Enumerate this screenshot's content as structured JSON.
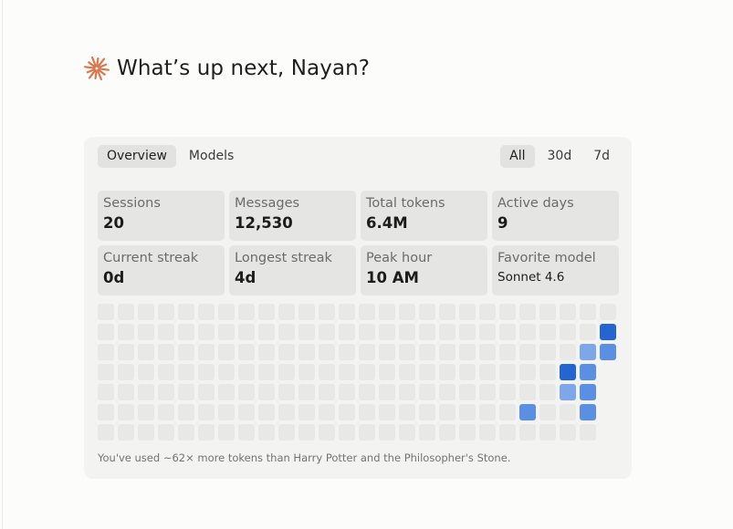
{
  "greeting": {
    "icon": "sparkle-icon",
    "text": "What’s up next, Nayan?",
    "accent_color": "#d9774f"
  },
  "tabs": {
    "left": [
      {
        "label": "Overview",
        "active": true
      },
      {
        "label": "Models",
        "active": false
      }
    ],
    "right": [
      {
        "label": "All",
        "active": true
      },
      {
        "label": "30d",
        "active": false
      },
      {
        "label": "7d",
        "active": false
      }
    ]
  },
  "stats": [
    {
      "label": "Sessions",
      "value": "20"
    },
    {
      "label": "Messages",
      "value": "12,530"
    },
    {
      "label": "Total tokens",
      "value": "6.4M"
    },
    {
      "label": "Active days",
      "value": "9"
    },
    {
      "label": "Current streak",
      "value": "0d"
    },
    {
      "label": "Longest streak",
      "value": "4d"
    },
    {
      "label": "Peak hour",
      "value": "10 AM"
    },
    {
      "label": "Favorite model",
      "value": "Sonnet 4.6"
    }
  ],
  "heatmap": {
    "columns": 26,
    "rows": 7,
    "colors": {
      "empty": "#e8e8e6",
      "level1": "#7ea7ea",
      "level2": "#5a8fe3",
      "level3": "#2565d1"
    },
    "active_cells": [
      {
        "col": 21,
        "row": 5,
        "level": 2
      },
      {
        "col": 23,
        "row": 3,
        "level": 3
      },
      {
        "col": 23,
        "row": 4,
        "level": 1
      },
      {
        "col": 24,
        "row": 2,
        "level": 1
      },
      {
        "col": 24,
        "row": 3,
        "level": 2
      },
      {
        "col": 24,
        "row": 4,
        "level": 2
      },
      {
        "col": 24,
        "row": 5,
        "level": 2
      },
      {
        "col": 25,
        "row": 1,
        "level": 3
      },
      {
        "col": 25,
        "row": 2,
        "level": 2
      }
    ],
    "last_column_rows": 3
  },
  "footnote": "You've used ~62× more tokens than Harry Potter and the Philosopher's Stone."
}
